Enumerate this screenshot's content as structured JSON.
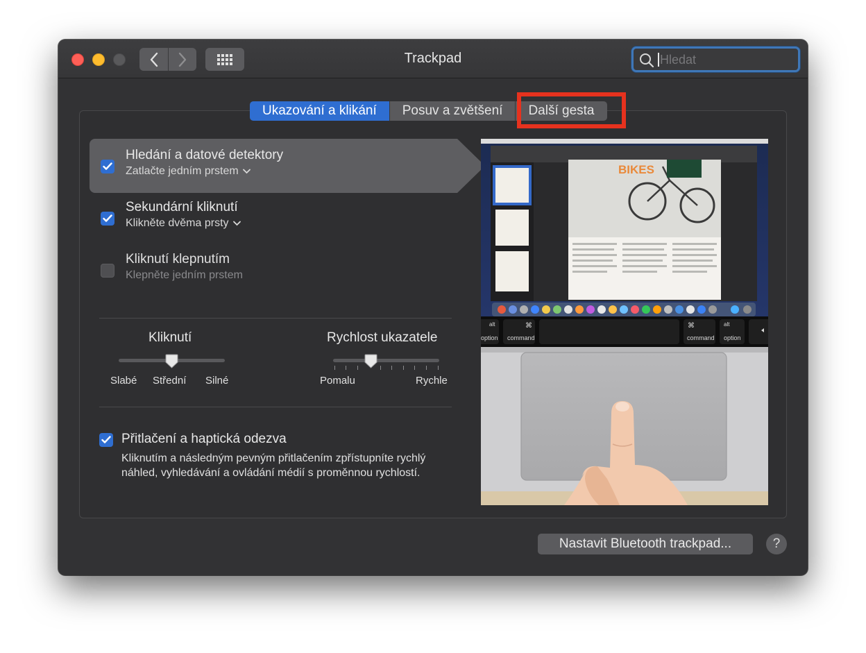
{
  "window": {
    "title": "Trackpad"
  },
  "search": {
    "placeholder": "Hledat"
  },
  "tabs": [
    {
      "label": "Ukazování a klikání",
      "active": true
    },
    {
      "label": "Posuv a zvětšení",
      "active": false
    },
    {
      "label": "Další gesta",
      "active": false
    }
  ],
  "options": [
    {
      "title": "Hledání a datové detektory",
      "subtitle": "Zatlačte jedním prstem",
      "checked": true,
      "selected": true
    },
    {
      "title": "Sekundární kliknutí",
      "subtitle": "Klikněte dvěma prsty",
      "checked": true,
      "selected": false
    },
    {
      "title": "Kliknutí klepnutím",
      "subtitle": "Klepněte jedním prstem",
      "checked": false,
      "selected": false
    }
  ],
  "click_slider": {
    "label": "Kliknutí",
    "min_label": "Slabé",
    "mid_label": "Střední",
    "max_label": "Silné",
    "level": 0.5
  },
  "speed_slider": {
    "label": "Rychlost ukazatele",
    "min_label": "Pomalu",
    "max_label": "Rychle",
    "level": 0.35
  },
  "force_touch": {
    "title": "Přitlačení a haptická odezva",
    "description": "Kliknutím a následným pevným přitlačením zpřístupníte rychlý náhled, vyhledávání a ovládání médií s proměnnou rychlostí.",
    "checked": true
  },
  "preview": {
    "doc_title": "BIKES",
    "keys": [
      "alt",
      "option",
      "⌘",
      "command",
      "⌘",
      "command",
      "alt",
      "option"
    ]
  },
  "buttons": {
    "bluetooth": "Nastavit Bluetooth trackpad...",
    "help": "?"
  },
  "colors": {
    "accent": "#2f6ed1",
    "highlight": "#e6321e"
  }
}
